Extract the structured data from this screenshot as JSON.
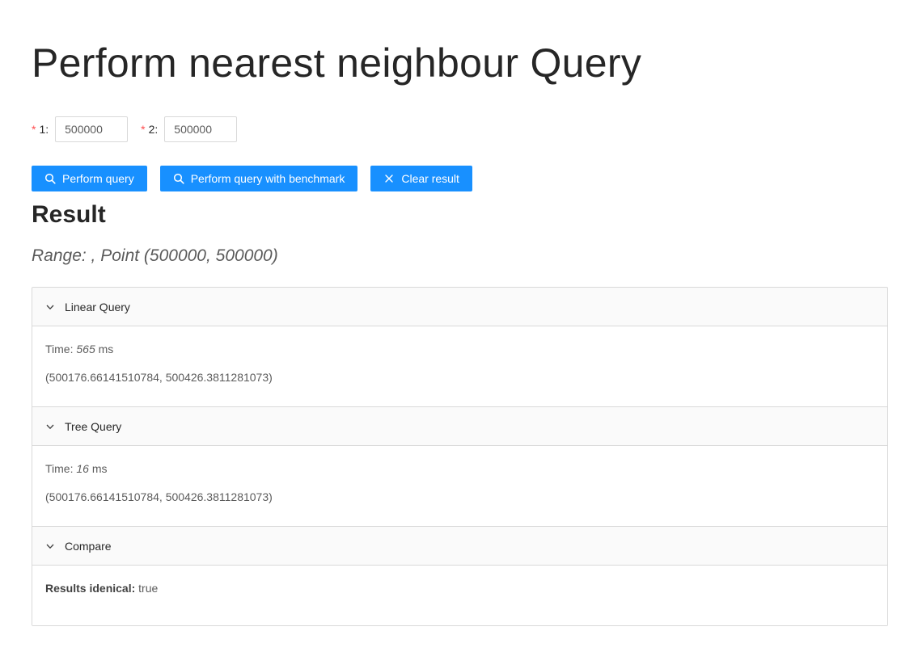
{
  "title": "Perform nearest neighbour Query",
  "form": {
    "required_mark": "*",
    "fields": [
      {
        "label": "1",
        "colon": ":",
        "value": "500000"
      },
      {
        "label": "2",
        "colon": ":",
        "value": "500000"
      }
    ]
  },
  "buttons": {
    "perform_query": "Perform query",
    "perform_benchmark": "Perform query with benchmark",
    "clear_result": "Clear result",
    "color": "#1890ff"
  },
  "result": {
    "heading": "Result",
    "range_text": "Range: , Point (500000, 500000)"
  },
  "panels": {
    "linear": {
      "header": "Linear Query",
      "time_label": "Time:",
      "time_value": "565",
      "time_unit": "ms",
      "point": "(500176.66141510784, 500426.3811281073)"
    },
    "tree": {
      "header": "Tree Query",
      "time_label": "Time:",
      "time_value": "16",
      "time_unit": "ms",
      "point": "(500176.66141510784, 500426.3811281073)"
    },
    "compare": {
      "header": "Compare",
      "label": "Results idenical:",
      "value": "true"
    }
  },
  "icons": {
    "search": "search-icon",
    "close": "close-icon",
    "collapse_arrow": "chevron-down-icon"
  }
}
